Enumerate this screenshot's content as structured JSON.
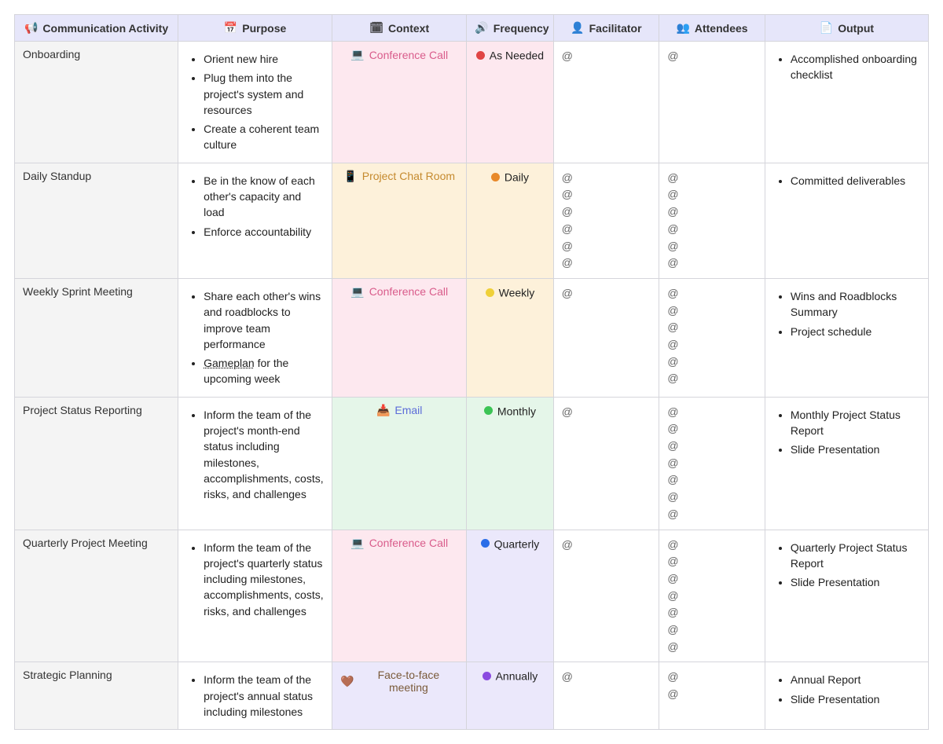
{
  "headers": {
    "activity": {
      "label": "Communication Activity",
      "icon": "📢"
    },
    "purpose": {
      "label": "Purpose",
      "icon": "📅"
    },
    "context": {
      "label": "Context",
      "icon": "🗓"
    },
    "frequency": {
      "label": "Frequency",
      "icon": "🔊"
    },
    "facilitator": {
      "label": "Facilitator",
      "icon": "👤"
    },
    "attendees": {
      "label": "Attendees",
      "icon": "👥"
    },
    "output": {
      "label": "Output",
      "icon": "📄"
    }
  },
  "context_types": {
    "conference_call": {
      "label": "Conference Call",
      "icon": "💻",
      "bg": "ctx-pink"
    },
    "project_chat": {
      "label": "Project Chat Room",
      "icon": "📱",
      "bg": "ctx-orange"
    },
    "email": {
      "label": "Email",
      "icon": "📥",
      "bg": "ctx-green"
    },
    "face_to_face": {
      "label": "Face-to-face meeting",
      "icon": "🤎",
      "bg": "ctx-purple",
      "extraClass": "ctx-brown"
    }
  },
  "frequency_types": {
    "as_needed": {
      "label": "As Needed",
      "dot": "red",
      "bg": "freq-pink"
    },
    "daily": {
      "label": "Daily",
      "dot": "orange",
      "bg": "freq-orange"
    },
    "weekly": {
      "label": "Weekly",
      "dot": "yellow",
      "bg": "freq-orange"
    },
    "monthly": {
      "label": "Monthly",
      "dot": "green",
      "bg": "freq-green"
    },
    "quarterly": {
      "label": "Quarterly",
      "dot": "blue",
      "bg": "freq-purple"
    },
    "annually": {
      "label": "Annually",
      "dot": "purple",
      "bg": "freq-purple"
    }
  },
  "rows": [
    {
      "activity": "Onboarding",
      "purpose": [
        "Orient new hire",
        "Plug them into the project's system and resources",
        "Create a coherent team culture"
      ],
      "context": "conference_call",
      "frequency": "as_needed",
      "facilitator_count": 1,
      "attendee_count": 1,
      "output": [
        "Accomplished onboarding checklist"
      ]
    },
    {
      "activity": "Daily Standup",
      "purpose": [
        "Be in the know of each other's capacity and load",
        "Enforce accountability"
      ],
      "context": "project_chat",
      "frequency": "daily",
      "facilitator_count": 6,
      "attendee_count": 6,
      "output": [
        "Committed deliverables"
      ]
    },
    {
      "activity": "Weekly Sprint Meeting",
      "purpose": [
        "Share each other's wins and roadblocks to improve team performance",
        "<span class='underline'>Gameplan</span> for the upcoming week"
      ],
      "context": "conference_call",
      "frequency": "weekly",
      "facilitator_count": 1,
      "attendee_count": 6,
      "output": [
        "Wins and Roadblocks Summary",
        "Project schedule"
      ]
    },
    {
      "activity": "Project Status Reporting",
      "purpose": [
        "Inform the team of the project's month-end status including milestones, accomplishments, costs, risks, and challenges"
      ],
      "context": "email",
      "frequency": "monthly",
      "facilitator_count": 1,
      "attendee_count": 7,
      "output": [
        "Monthly Project Status Report",
        "Slide Presentation"
      ]
    },
    {
      "activity": "Quarterly Project Meeting",
      "purpose": [
        "Inform the team of the project's quarterly status including milestones, accomplishments, costs, risks, and challenges"
      ],
      "context": "conference_call",
      "frequency": "quarterly",
      "facilitator_count": 1,
      "attendee_count": 7,
      "output": [
        "Quarterly Project Status Report",
        "Slide Presentation"
      ]
    },
    {
      "activity": "Strategic Planning",
      "purpose": [
        "Inform the team of the project's annual status including milestones"
      ],
      "context": "face_to_face",
      "frequency": "annually",
      "facilitator_count": 1,
      "attendee_count": 2,
      "output": [
        "Annual Report",
        "Slide Presentation"
      ],
      "truncated": true
    }
  ]
}
